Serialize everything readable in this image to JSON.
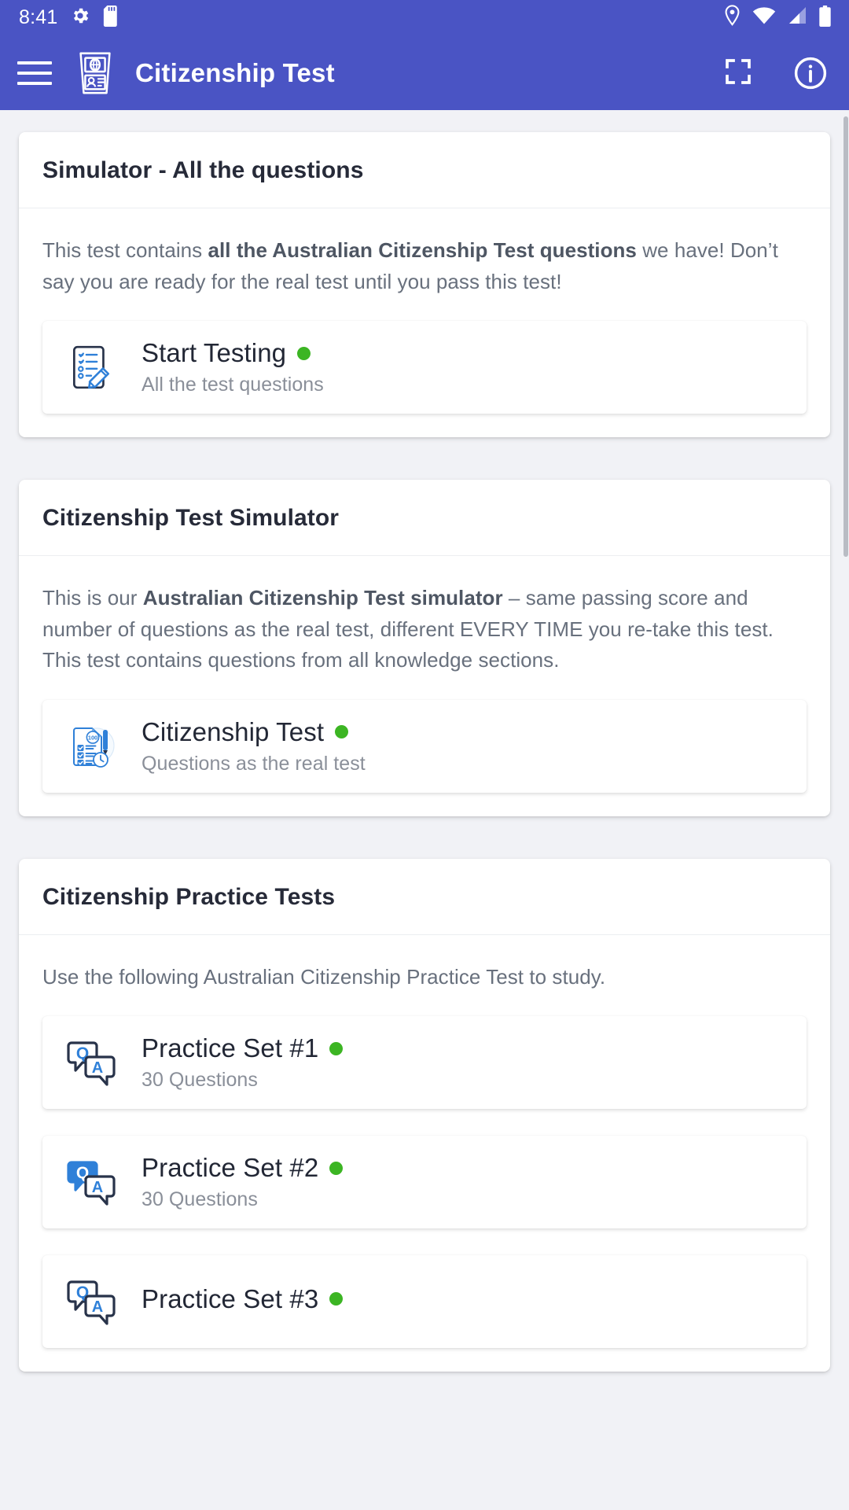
{
  "status_bar": {
    "time": "8:41",
    "left_icons": [
      "gear-icon",
      "sd-card-icon"
    ],
    "right_icons": [
      "location-pin-icon",
      "wifi-icon",
      "cellular-signal-icon",
      "battery-icon"
    ]
  },
  "app_bar": {
    "menu_icon": "hamburger-menu-icon",
    "logo_icon": "citizenship-id-card-icon",
    "title": "Citizenship Test",
    "actions": [
      {
        "icon": "fullscreen-icon"
      },
      {
        "icon": "info-icon"
      }
    ]
  },
  "theme": {
    "primary": "#4a54c4",
    "background": "#f1f2f6",
    "card": "#ffffff",
    "title_text": "#262a38",
    "body_text": "#68707d",
    "status_dot": "#3cb523",
    "icon_blue": "#2f80d8",
    "icon_navy": "#28334a"
  },
  "cards": [
    {
      "title": "Simulator - All the questions",
      "description_parts": [
        {
          "text": "This test contains ",
          "bold": false
        },
        {
          "text": "all the Australian Citizenship Test questions",
          "bold": true
        },
        {
          "text": " we have! Don’t say you are ready for the real test until you pass this test!",
          "bold": false
        }
      ],
      "items": [
        {
          "icon": "checklist-pencil-icon",
          "title": "Start Testing",
          "subtitle": "All the test questions",
          "status": "available"
        }
      ]
    },
    {
      "title": "Citizenship Test Simulator",
      "description_parts": [
        {
          "text": "This is our ",
          "bold": false
        },
        {
          "text": "Australian Citizenship Test simulator",
          "bold": true
        },
        {
          "text": " – same passing score and number of questions as the real test, different EVERY TIME you re-take this test. This test contains questions from all knowledge sections.",
          "bold": false
        }
      ],
      "items": [
        {
          "icon": "exam-document-clock-icon",
          "title": "Citizenship Test",
          "subtitle": "Questions as the real test",
          "status": "available"
        }
      ]
    },
    {
      "title": "Citizenship Practice Tests",
      "description_parts": [
        {
          "text": "Use the following Australian Citizenship Practice Test to study.",
          "bold": false
        }
      ],
      "items": [
        {
          "icon": "qa-speech-bubbles-outline-icon",
          "title": "Practice Set #1",
          "subtitle": "30 Questions",
          "status": "available"
        },
        {
          "icon": "qa-speech-bubbles-filled-icon",
          "title": "Practice Set #2",
          "subtitle": "30 Questions",
          "status": "available"
        },
        {
          "icon": "qa-speech-bubbles-outline-icon",
          "title": "Practice Set #3",
          "subtitle": "",
          "status": "available"
        }
      ]
    }
  ]
}
